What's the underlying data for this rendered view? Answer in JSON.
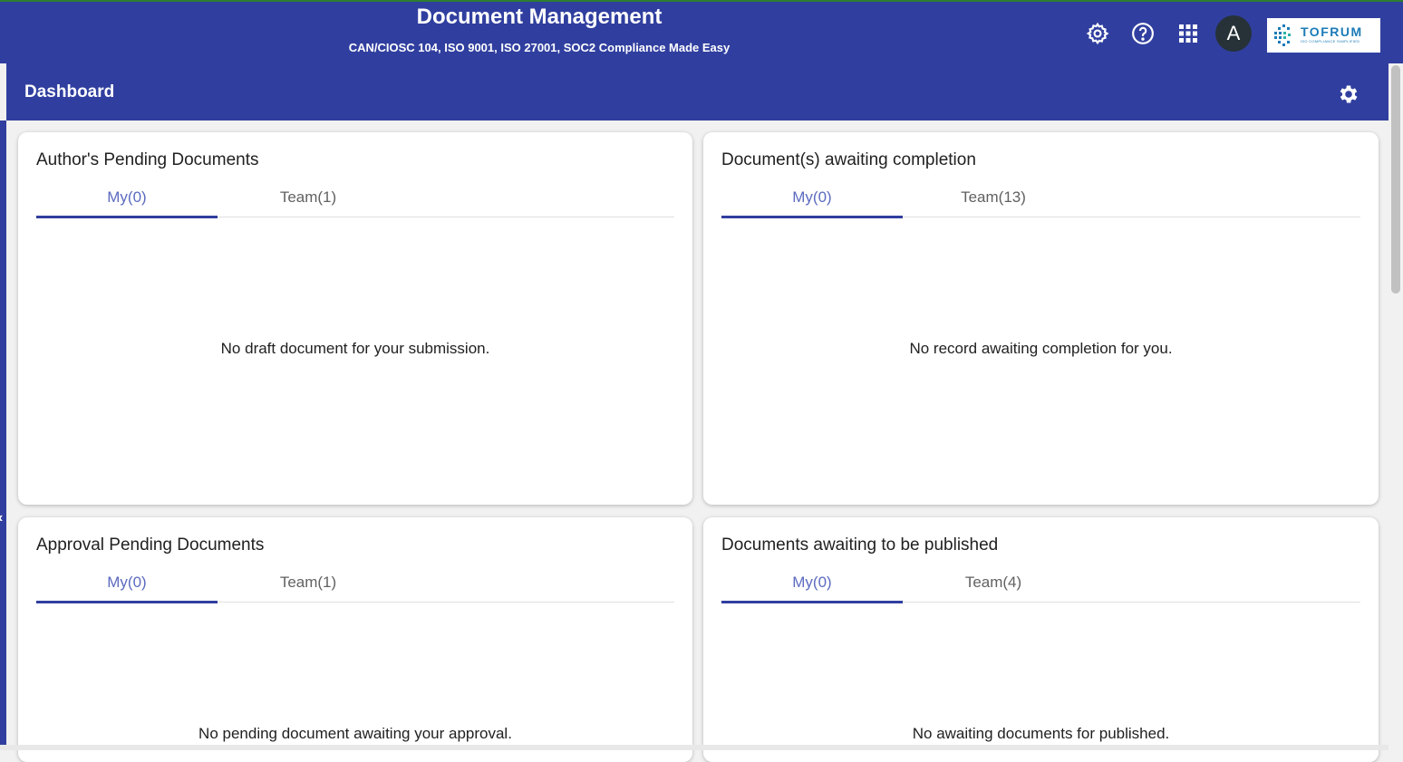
{
  "header": {
    "title": "Document Management",
    "subtitle": "CAN/CIOSC 104, ISO 9001, ISO 27001, SOC2 Compliance Made Easy",
    "avatar_initial": "A",
    "logo_text": "TOFRUM",
    "logo_tagline": "ISO COMPLIANCE SIMPLIFIED"
  },
  "subheader": {
    "title": "Dashboard"
  },
  "cards": [
    {
      "title": "Author's Pending Documents",
      "tabs": [
        "My(0)",
        "Team(1)"
      ],
      "active_tab": 0,
      "message": "No draft document for your submission."
    },
    {
      "title": "Document(s) awaiting completion",
      "tabs": [
        "My(0)",
        "Team(13)"
      ],
      "active_tab": 0,
      "message": "No record awaiting completion for you."
    },
    {
      "title": "Approval Pending Documents",
      "tabs": [
        "My(0)",
        "Team(1)"
      ],
      "active_tab": 0,
      "message": "No pending document awaiting your approval."
    },
    {
      "title": "Documents awaiting to be published",
      "tabs": [
        "My(0)",
        "Team(4)"
      ],
      "active_tab": 0,
      "message": "No awaiting documents for published."
    }
  ],
  "colors": {
    "primary": "#303f9f",
    "active_tab_text": "#5c6bc0",
    "top_border": "#2e7d32"
  },
  "icons": {
    "settings": "gear-icon",
    "help": "help-circle-icon",
    "apps": "apps-grid-icon",
    "dashboard_settings": "gear-icon"
  }
}
